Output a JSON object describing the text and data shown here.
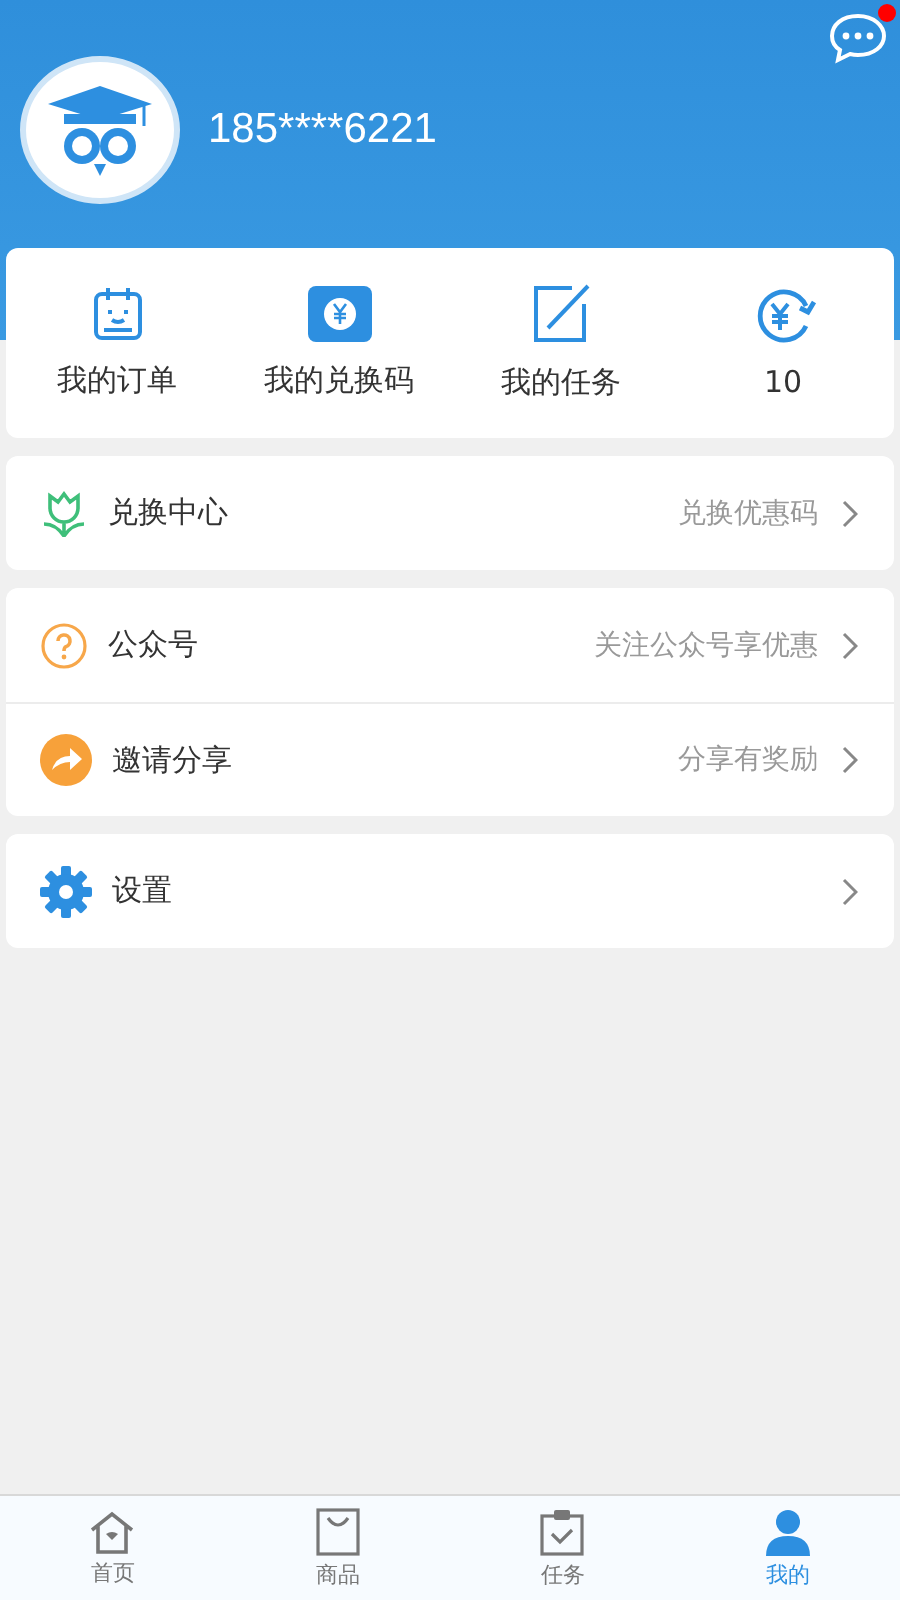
{
  "header": {
    "phone": "185****6221",
    "messages_unread": true
  },
  "quick_actions": [
    {
      "kind": "order",
      "label": "我的订单"
    },
    {
      "kind": "code",
      "label": "我的兑换码"
    },
    {
      "kind": "task",
      "label": "我的任务"
    },
    {
      "kind": "coin",
      "label": "10"
    }
  ],
  "menu_groups": [
    [
      {
        "kind": "exchange",
        "title": "兑换中心",
        "hint": "兑换优惠码"
      }
    ],
    [
      {
        "kind": "account",
        "title": "公众号",
        "hint": "关注公众号享优惠"
      },
      {
        "kind": "share",
        "title": "邀请分享",
        "hint": "分享有奖励"
      }
    ],
    [
      {
        "kind": "settings",
        "title": "设置"
      }
    ]
  ],
  "tab_bar": [
    {
      "kind": "home",
      "label": "首页",
      "selected": false
    },
    {
      "kind": "goods",
      "label": "商品",
      "selected": false
    },
    {
      "kind": "tasks",
      "label": "任务",
      "selected": false
    },
    {
      "kind": "me",
      "label": "我的",
      "selected": true
    }
  ]
}
